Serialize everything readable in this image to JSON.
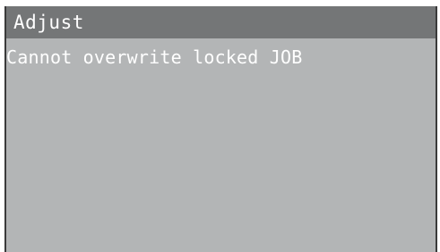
{
  "screen": {
    "title": "Adjust",
    "message": "Cannot overwrite locked JOB"
  },
  "colors": {
    "screen_background": "#b3b5b6",
    "title_bar_background": "#747677",
    "text": "#ffffff",
    "frame": "#3a3a3a"
  }
}
